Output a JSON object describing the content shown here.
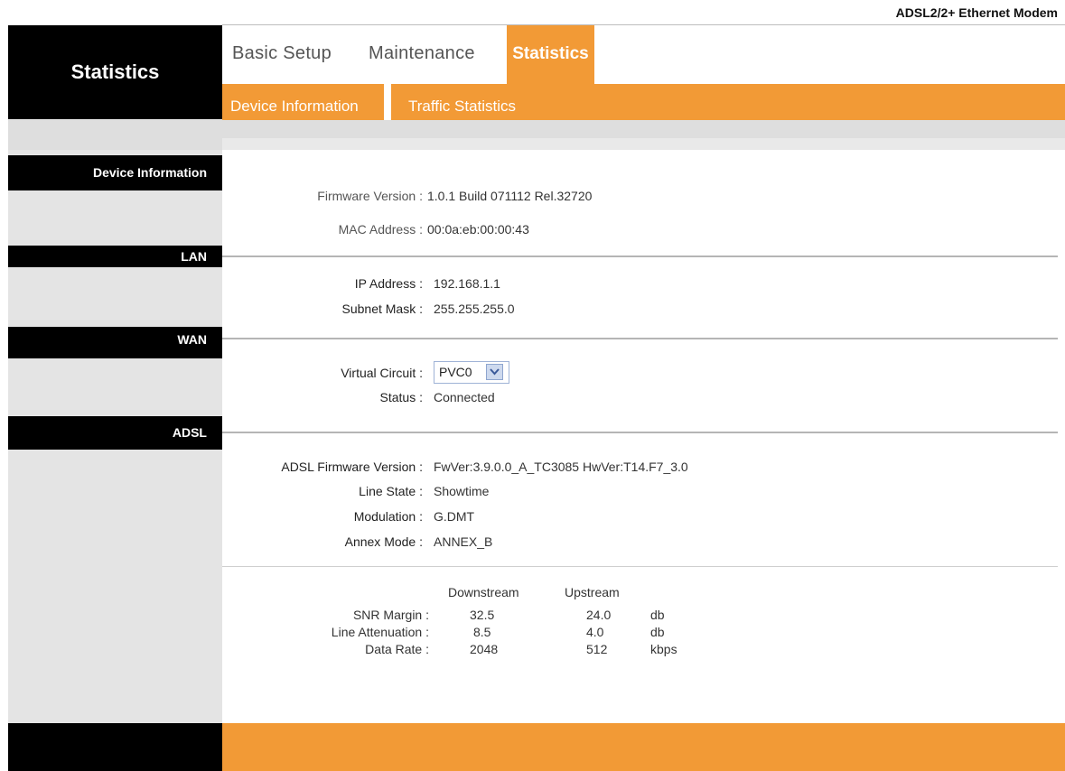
{
  "product_name": "ADSL2/2+ Ethernet Modem",
  "logo": "Statistics",
  "tabs": [
    {
      "label": "Basic Setup"
    },
    {
      "label": "Maintenance"
    },
    {
      "label": "Statistics"
    }
  ],
  "subtabs": [
    {
      "label": "Device Information"
    },
    {
      "label": "Traffic Statistics"
    }
  ],
  "sections": {
    "device": "Device Information",
    "lan": "LAN",
    "wan": "WAN",
    "adsl": "ADSL"
  },
  "device": {
    "firmware_label": "Firmware Version :",
    "firmware_value": "1.0.1 Build 071112 Rel.32720",
    "mac_label": "MAC Address :",
    "mac_value": "00:0a:eb:00:00:43"
  },
  "lan": {
    "ip_label": "IP Address :",
    "ip_value": "192.168.1.1",
    "mask_label": "Subnet Mask :",
    "mask_value": "255.255.255.0"
  },
  "wan": {
    "vc_label": "Virtual Circuit :",
    "vc_value": "PVC0",
    "status_label": "Status :",
    "status_value": "Connected"
  },
  "adsl": {
    "fw_label": "ADSL Firmware Version :",
    "fw_value": "FwVer:3.9.0.0_A_TC3085 HwVer:T14.F7_3.0",
    "line_state_label": "Line State :",
    "line_state_value": "Showtime",
    "modulation_label": "Modulation :",
    "modulation_value": "G.DMT",
    "annex_label": "Annex Mode :",
    "annex_value": "ANNEX_B"
  },
  "stats": {
    "headers": {
      "downstream": "Downstream",
      "upstream": "Upstream"
    },
    "rows": [
      {
        "label": "SNR Margin :",
        "down": "32.5",
        "up": "24.0",
        "unit": "db"
      },
      {
        "label": "Line Attenuation :",
        "down": "8.5",
        "up": "4.0",
        "unit": "db"
      },
      {
        "label": "Data Rate :",
        "down": "2048",
        "up": "512",
        "unit": "kbps"
      }
    ]
  },
  "colors": {
    "accent": "#f29a36",
    "black": "#000000"
  }
}
